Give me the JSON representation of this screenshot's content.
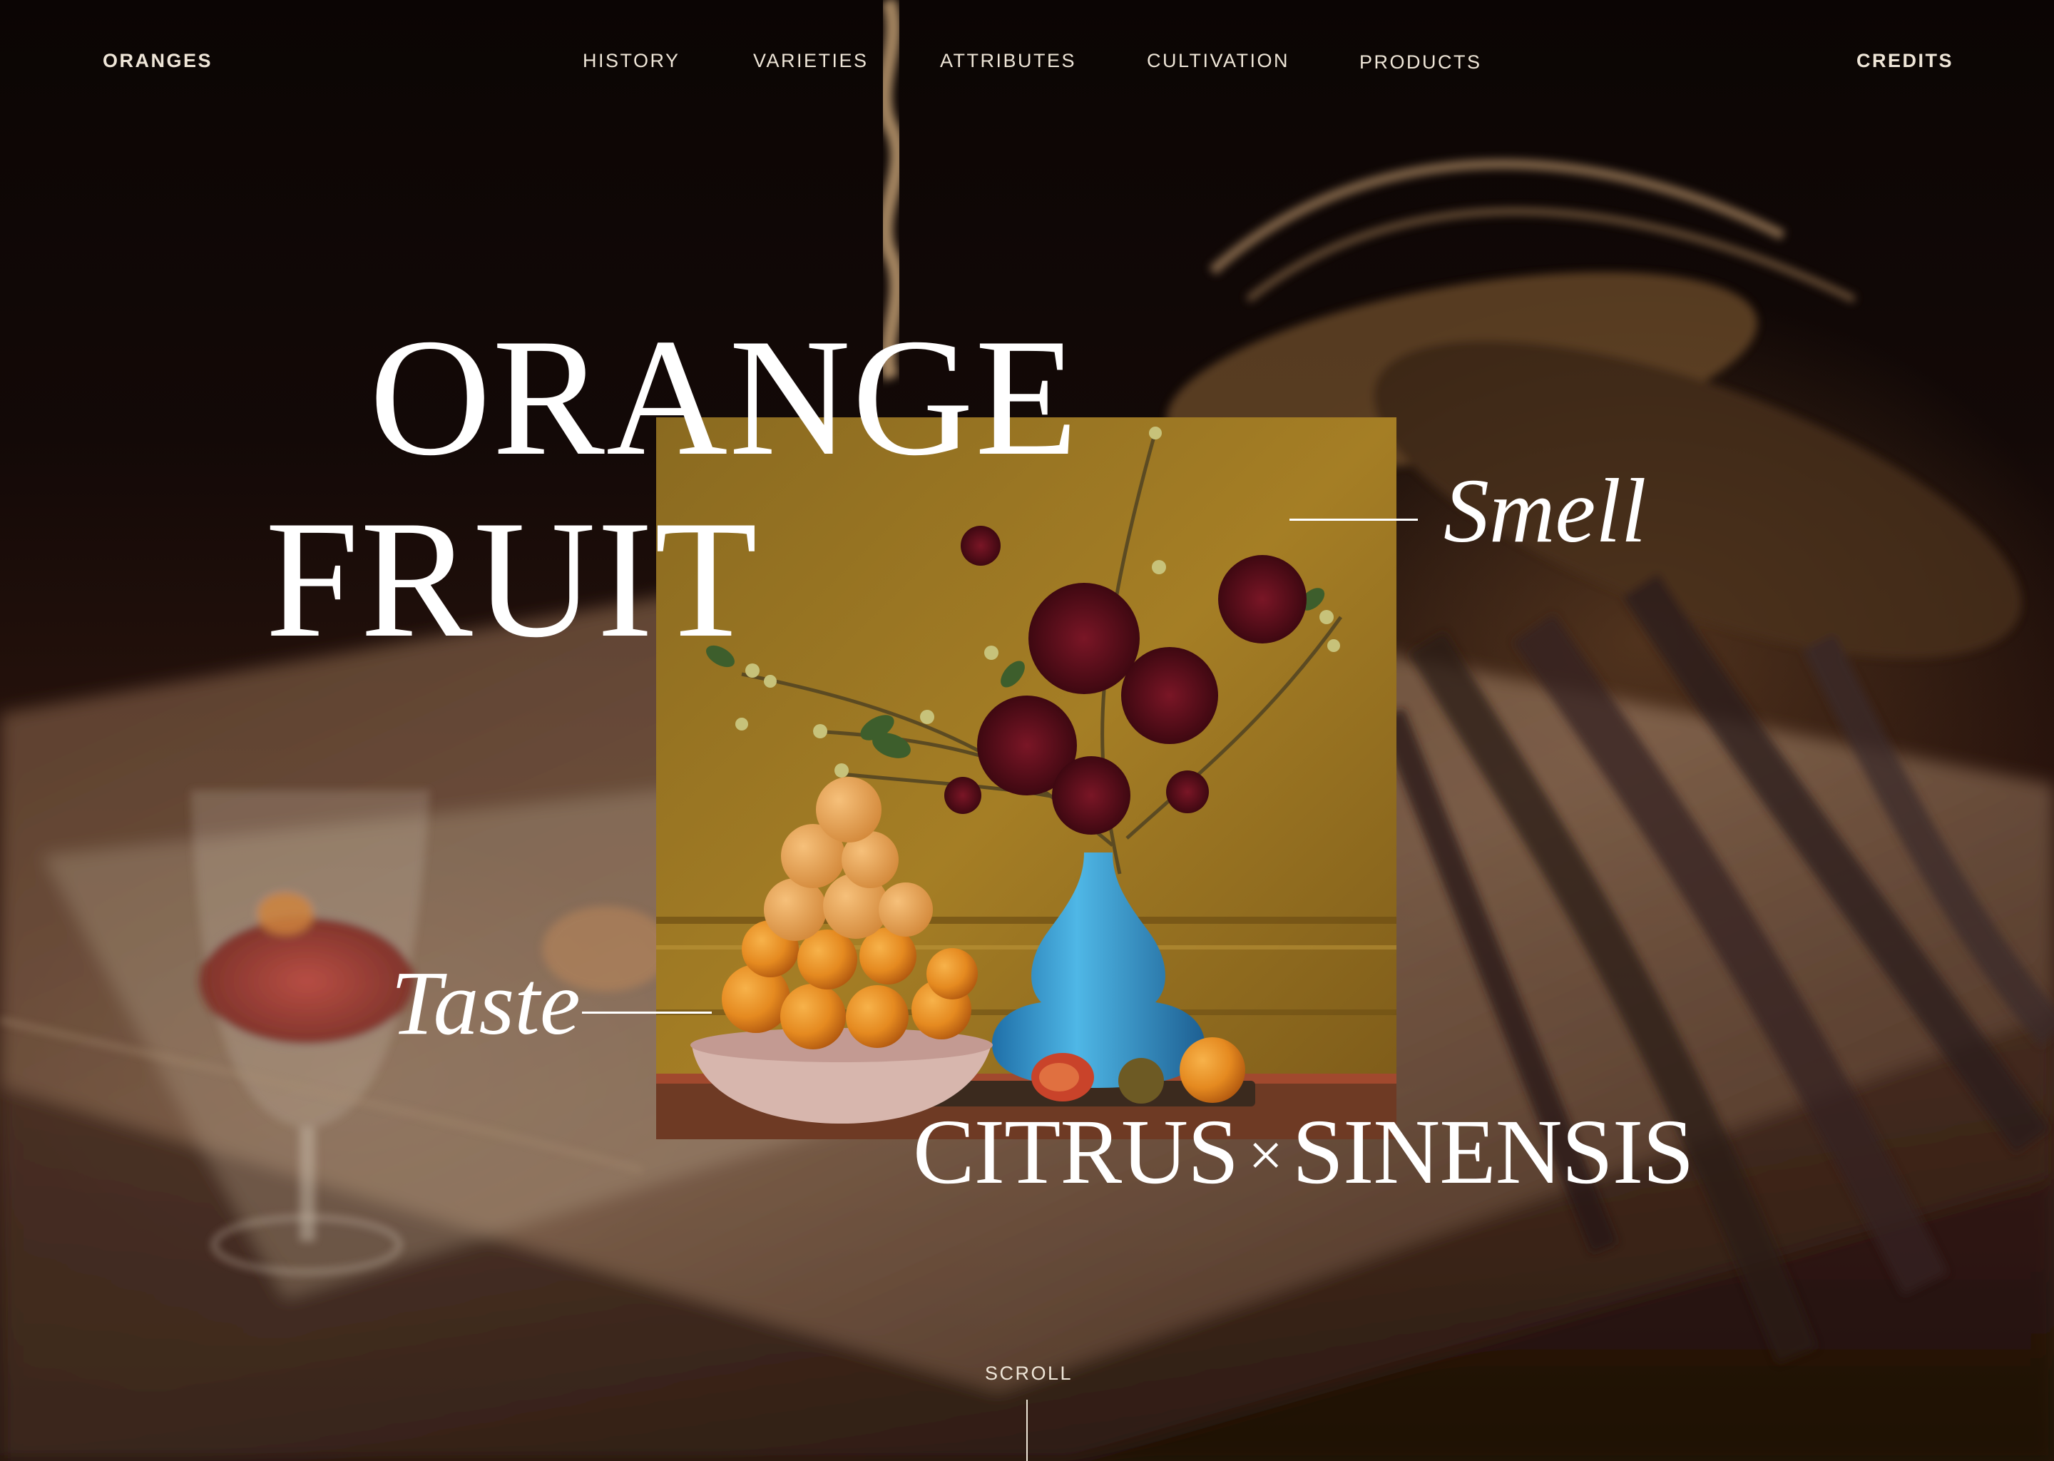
{
  "nav": {
    "brand": "ORANGES",
    "items": [
      "HISTORY",
      "VARIETIES",
      "ATTRIBUTES",
      "CULTIVATION",
      "PRODUCTS"
    ],
    "credits": "CREDITS"
  },
  "hero": {
    "title_line1": "ORANGE",
    "title_line2": "FRUIT",
    "accent_smell": "Smell",
    "accent_taste": "Taste",
    "scientific_genus": "CITRUS",
    "scientific_cross": "×",
    "scientific_species": "SINENSIS"
  },
  "scroll": {
    "label": "SCROLL"
  },
  "colors": {
    "text": "#ffffff",
    "nav_text": "#efe6d8",
    "background": "#120806",
    "photo_wall": "#a37a1f",
    "vase": "#3aa6d8",
    "flowers": "#5a0f1c",
    "fruit": "#e7912a"
  }
}
